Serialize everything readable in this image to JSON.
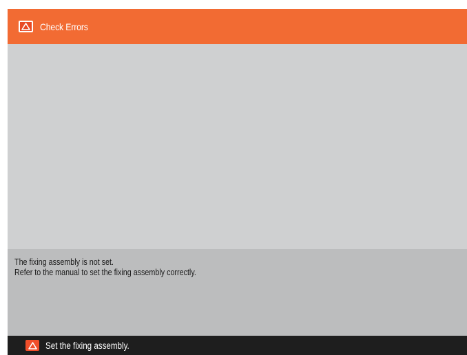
{
  "header": {
    "title": "Check Errors",
    "icon": "warning-triangle-icon",
    "background_color": "#f26b33"
  },
  "message": {
    "line1": "The fixing assembly is not set.",
    "line2": "Refer to the manual to set the fixing assembly correctly."
  },
  "status_bar": {
    "text": "Set the fixing assembly.",
    "icon": "warning-triangle-icon",
    "icon_color": "#f04e2a"
  }
}
